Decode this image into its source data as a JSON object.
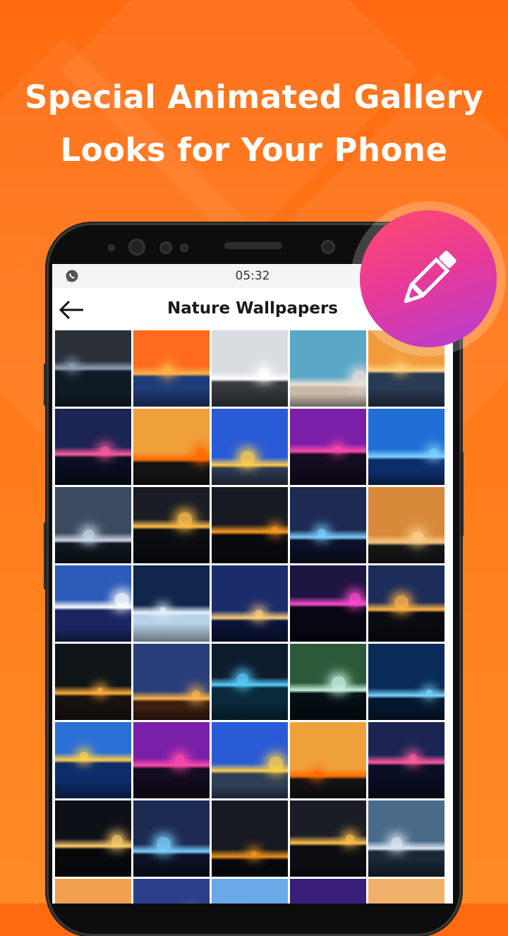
{
  "headline": {
    "line1": "Special Animated Gallery",
    "line2": "Looks for Your Phone"
  },
  "status_bar": {
    "time": "05:32",
    "left_icon": "whatsapp-icon"
  },
  "app_bar": {
    "title": "Nature Wallpapers",
    "back_icon": "arrow-left-icon"
  },
  "edit_button": {
    "icon": "pencil-icon"
  },
  "colors": {
    "background_top": "#ff6a10",
    "background_bottom": "#ff8a26",
    "edit_gradient_start": "#ff4a6d",
    "edit_gradient_end": "#b43ed6"
  },
  "wallpapers": [
    {
      "sky": "#2a2f38",
      "ground": "#0f1a24",
      "accent": "#8fa3b8"
    },
    {
      "sky": "#ff6a1e",
      "ground": "#1f3c7a",
      "accent": "#ffb347"
    },
    {
      "sky": "#d9dde2",
      "ground": "#3b3f44",
      "accent": "#ffffff"
    },
    {
      "sky": "#5aa7c8",
      "ground": "#c9b9a9",
      "accent": "#e8e1d8"
    },
    {
      "sky": "#f29b3c",
      "ground": "#2a3a52",
      "accent": "#ffd27a"
    },
    {
      "sky": "#1b2452",
      "ground": "#0b0f25",
      "accent": "#ff5aa0"
    },
    {
      "sky": "#f0a03a",
      "ground": "#141414",
      "accent": "#ff6a00"
    },
    {
      "sky": "#2a5bd6",
      "ground": "#2f3e56",
      "accent": "#ffcf4a"
    },
    {
      "sky": "#7a1fa8",
      "ground": "#140c20",
      "accent": "#ff4aa8"
    },
    {
      "sky": "#1f6fd6",
      "ground": "#0d2c6a",
      "accent": "#7fd4ff"
    },
    {
      "sky": "#3b4a5e",
      "ground": "#0f1620",
      "accent": "#c9d6e6"
    },
    {
      "sky": "#1a1d26",
      "ground": "#0b0d12",
      "accent": "#ffc14a"
    },
    {
      "sky": "#171a22",
      "ground": "#090a10",
      "accent": "#ff9a1e"
    },
    {
      "sky": "#1d2a52",
      "ground": "#0c1228",
      "accent": "#7ad0ff"
    },
    {
      "sky": "#d88a3a",
      "ground": "#1a1a1a",
      "accent": "#ffd28a"
    },
    {
      "sky": "#2b5ab8",
      "ground": "#1a2460",
      "accent": "#ffffff"
    },
    {
      "sky": "#10264a",
      "ground": "#b8d3e8",
      "accent": "#e8f4ff"
    },
    {
      "sky": "#1b2c6a",
      "ground": "#0c1640",
      "accent": "#ffcf7a"
    },
    {
      "sky": "#1e1540",
      "ground": "#070612",
      "accent": "#ff4ad0"
    },
    {
      "sky": "#1c2d5a",
      "ground": "#0b0b12",
      "accent": "#ffb347"
    },
    {
      "sky": "#0f1418",
      "ground": "#1a1410",
      "accent": "#ffae3a"
    },
    {
      "sky": "#2a3f7a",
      "ground": "#3a1f10",
      "accent": "#ffb54a"
    },
    {
      "sky": "#0d1d2e",
      "ground": "#0a2a3a",
      "accent": "#58d0ff"
    },
    {
      "sky": "#2b5a3a",
      "ground": "#041016",
      "accent": "#c8f0e0"
    },
    {
      "sky": "#0a2a5a",
      "ground": "#04172e",
      "accent": "#7ad4ff"
    },
    {
      "sky": "#2a6fd6",
      "ground": "#0d2c6a",
      "accent": "#ffcf4a"
    },
    {
      "sky": "#7a1fa8",
      "ground": "#140c20",
      "accent": "#ff4aa8"
    },
    {
      "sky": "#2a5bd6",
      "ground": "#2f3e56",
      "accent": "#ffcf4a"
    },
    {
      "sky": "#f0a03a",
      "ground": "#141414",
      "accent": "#ff6a00"
    },
    {
      "sky": "#1b2452",
      "ground": "#0b0f25",
      "accent": "#ff5aa0"
    },
    {
      "sky": "#0e1018",
      "ground": "#07080c",
      "accent": "#ffcf6a"
    },
    {
      "sky": "#1d2a52",
      "ground": "#0c1228",
      "accent": "#7ad0ff"
    },
    {
      "sky": "#171a22",
      "ground": "#090a10",
      "accent": "#ff9a1e"
    },
    {
      "sky": "#1a1d26",
      "ground": "#0b0d12",
      "accent": "#ffc14a"
    },
    {
      "sky": "#4a6a8a",
      "ground": "#1a2838",
      "accent": "#dfe8f2"
    },
    {
      "sky": "#f0a050",
      "ground": "#2a2a2a",
      "accent": "#ffd29a"
    },
    {
      "sky": "#2b3f8a",
      "ground": "#0d1230",
      "accent": "#ffffff"
    },
    {
      "sky": "#6aa8e8",
      "ground": "#2a2a3a",
      "accent": "#ffffff"
    },
    {
      "sky": "#3a1f7a",
      "ground": "#0b0820",
      "accent": "#ff6ad8"
    },
    {
      "sky": "#f0b06a",
      "ground": "#3a2a1a",
      "accent": "#ffe0a8"
    }
  ]
}
